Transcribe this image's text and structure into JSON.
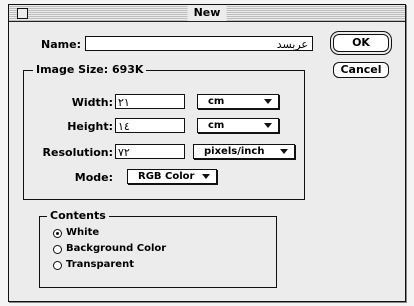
{
  "window": {
    "title": "New"
  },
  "name": {
    "label": "Name:",
    "value": "عربسد"
  },
  "image_size": {
    "label": "Image Size:",
    "value": "693K"
  },
  "width": {
    "label": "Width:",
    "value": "٢١",
    "unit": "cm"
  },
  "height": {
    "label": "Height:",
    "value": "١٤",
    "unit": "cm"
  },
  "resolution": {
    "label": "Resolution:",
    "value": "٧٢",
    "unit": "pixels/inch"
  },
  "mode": {
    "label": "Mode:",
    "value": "RGB Color"
  },
  "contents": {
    "title": "Contents",
    "options": [
      {
        "label": "White",
        "selected": true
      },
      {
        "label": "Background Color",
        "selected": false
      },
      {
        "label": "Transparent",
        "selected": false
      }
    ]
  },
  "buttons": {
    "ok": "OK",
    "cancel": "Cancel"
  }
}
